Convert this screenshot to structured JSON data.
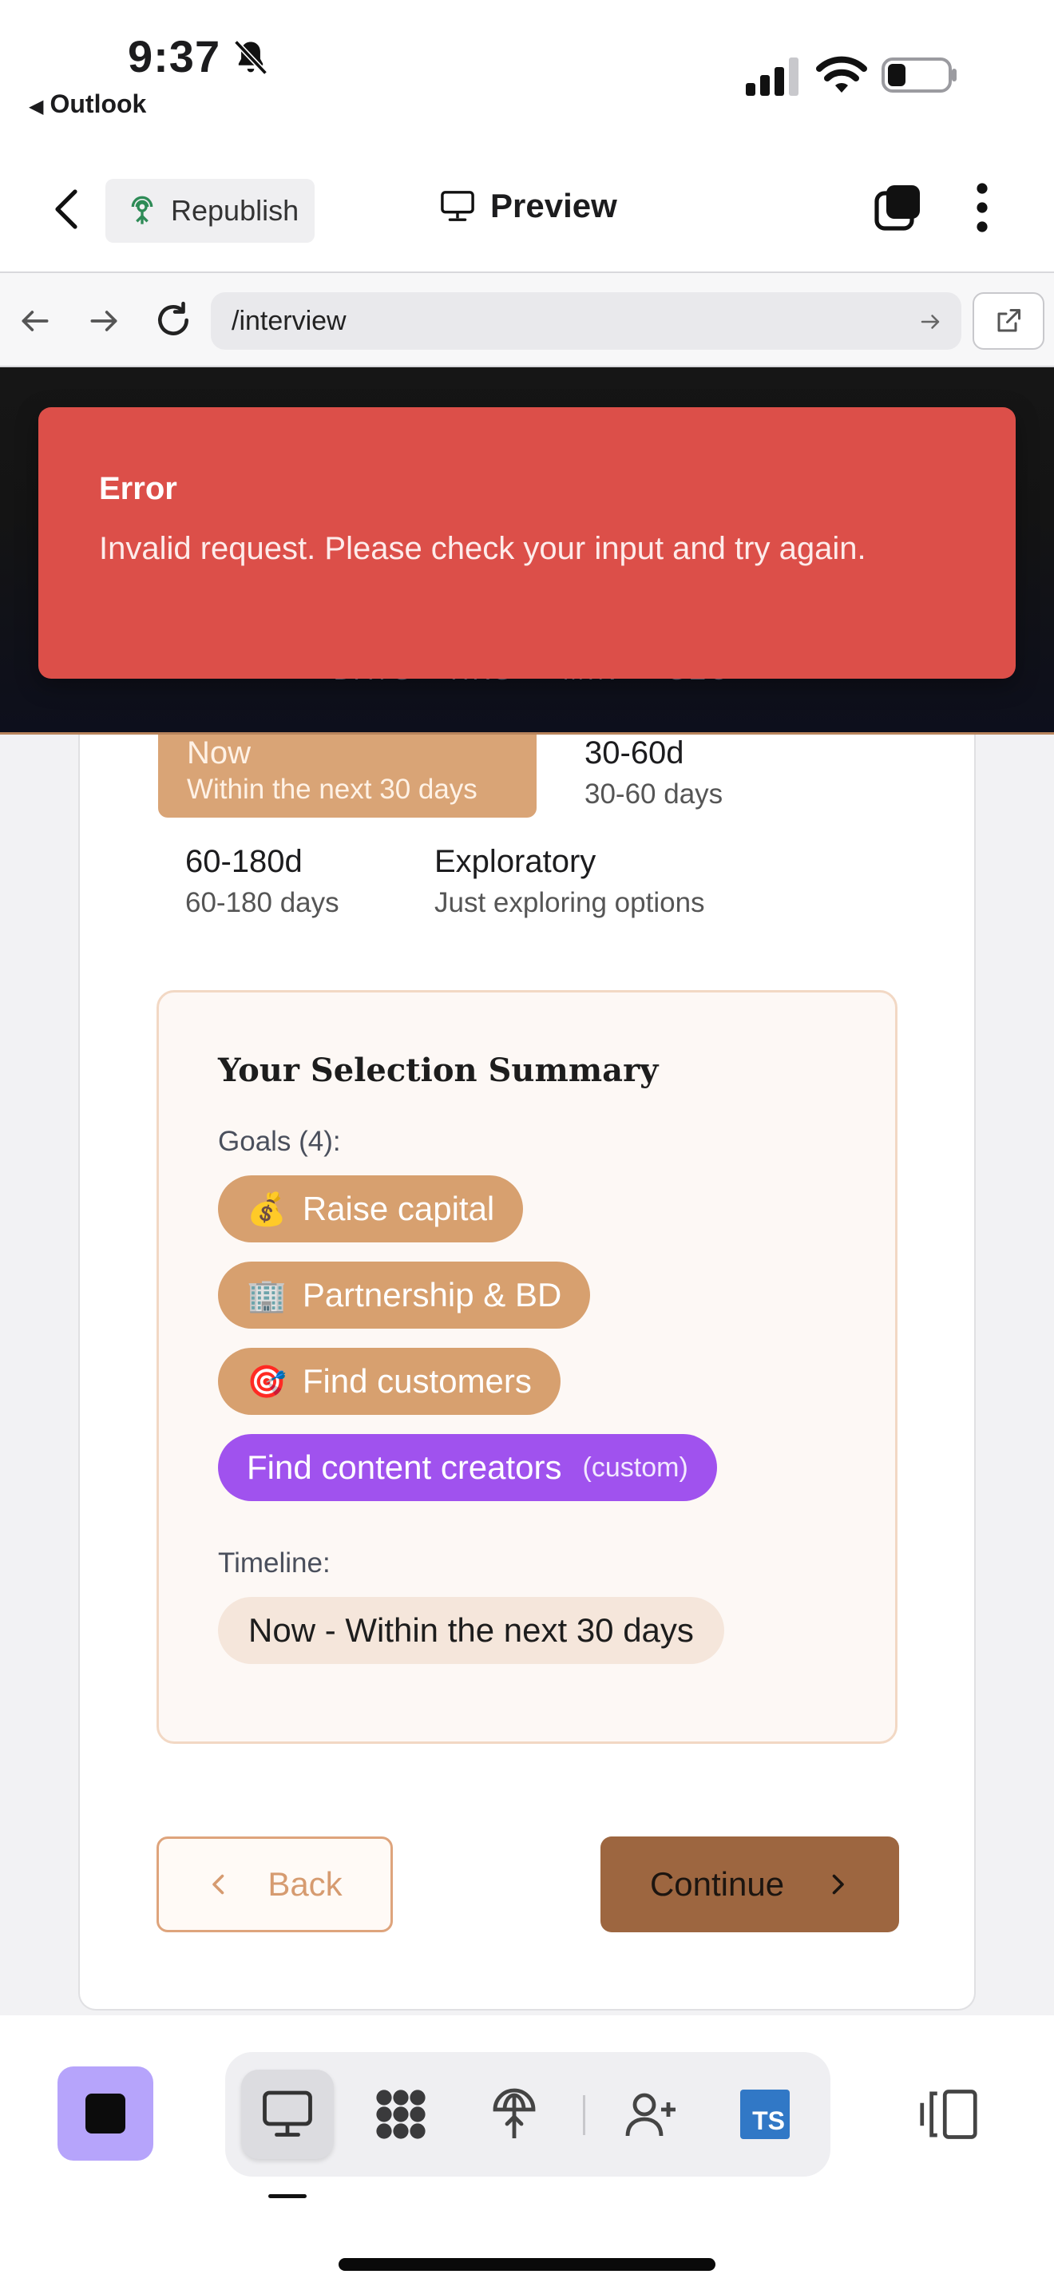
{
  "status_bar": {
    "time": "9:37",
    "back_app": "Outlook"
  },
  "header": {
    "republish_label": "Republish",
    "title": "Preview"
  },
  "browser": {
    "url": "/interview"
  },
  "countdown_labels": [
    "DAYS",
    "HRS",
    "MIN",
    "SEC"
  ],
  "toast": {
    "title": "Error",
    "message": "Invalid request. Please check your input and try again.",
    "color": "#dc4f49"
  },
  "timeline_options": [
    {
      "name": "Now",
      "desc": "Within the next 30 days",
      "selected": true
    },
    {
      "name": "30-60d",
      "desc": "30-60 days",
      "selected": false
    },
    {
      "name": "60-180d",
      "desc": "60-180 days",
      "selected": false
    },
    {
      "name": "Exploratory",
      "desc": "Just exploring options",
      "selected": false
    }
  ],
  "summary": {
    "title": "Your Selection Summary",
    "goals_label": "Goals (4):",
    "goals": [
      {
        "emoji": "💰",
        "label": "Raise capital"
      },
      {
        "emoji": "🏢",
        "label": "Partnership & BD"
      },
      {
        "emoji": "🎯",
        "label": "Find customers"
      }
    ],
    "custom_goal": {
      "label": "Find content creators",
      "tag": "(custom)"
    },
    "timeline_label": "Timeline:",
    "timeline_value": "Now - Within the next 30 days"
  },
  "buttons": {
    "back": "Back",
    "continue": "Continue"
  },
  "toolbar": {
    "ts_label": "TS",
    "active_tool": "desktop-preview"
  },
  "colors": {
    "accent": "#d7a06f",
    "custom_chip": "#a052ee",
    "continue": "#9d6640",
    "stop_button": "#b6a4fb"
  }
}
